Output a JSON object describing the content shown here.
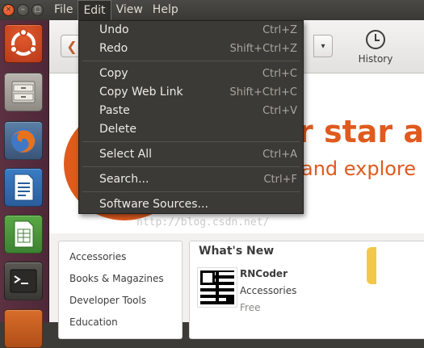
{
  "menubar": {
    "items": [
      {
        "label": "File",
        "active": false
      },
      {
        "label": "Edit",
        "active": true
      },
      {
        "label": "View",
        "active": false
      },
      {
        "label": "Help",
        "active": false
      }
    ]
  },
  "window_buttons": {
    "close": "×",
    "minimize": "–",
    "maximize": "□"
  },
  "launcher": [
    {
      "name": "ubuntu-software-center-icon"
    },
    {
      "name": "files-icon"
    },
    {
      "name": "firefox-icon"
    },
    {
      "name": "libreoffice-writer-icon"
    },
    {
      "name": "libreoffice-calc-icon"
    },
    {
      "name": "terminal-icon"
    }
  ],
  "toolbar": {
    "back_glyph": "❮",
    "dropdown_glyph": "▾",
    "history_label": "History"
  },
  "banner": {
    "line1": "r star a",
    "line2": "and explore"
  },
  "watermark": "http://blog.csdn.net/",
  "edit_menu": {
    "items": [
      {
        "label": "Undo",
        "accel": "Ctrl+Z"
      },
      {
        "label": "Redo",
        "accel": "Shift+Ctrl+Z"
      },
      {
        "label": "Copy",
        "accel": "Ctrl+C"
      },
      {
        "label": "Copy Web Link",
        "accel": "Shift+Ctrl+C"
      },
      {
        "label": "Paste",
        "accel": "Ctrl+V"
      },
      {
        "label": "Delete",
        "accel": ""
      },
      {
        "label": "Select All",
        "accel": "Ctrl+A"
      },
      {
        "label": "Search...",
        "accel": "Ctrl+F"
      },
      {
        "label": "Software Sources...",
        "accel": ""
      }
    ]
  },
  "categories": [
    "Accessories",
    "Books & Magazines",
    "Developer Tools",
    "Education"
  ],
  "whats_new": {
    "title": "What's New",
    "app_name": "RNCoder",
    "app_category": "Accessories",
    "app_price": "Free"
  },
  "colors": {
    "accent": "#e05a1e",
    "menu_bg": "#3b3a36",
    "launcher_bg": "#5c3141"
  }
}
